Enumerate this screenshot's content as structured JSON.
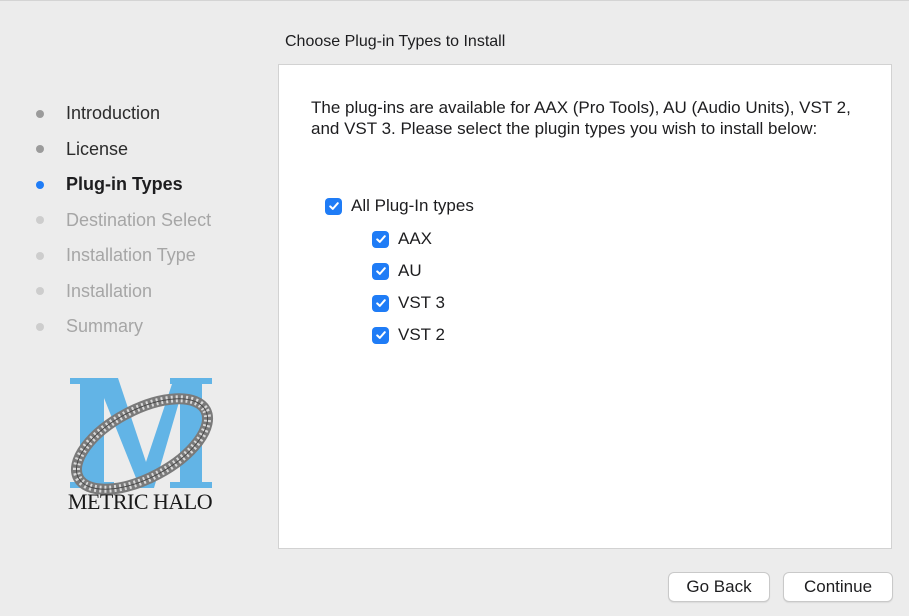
{
  "header": {
    "title": "Choose Plug-in Types to Install"
  },
  "sidebar": {
    "steps": [
      {
        "label": "Introduction",
        "state": "done"
      },
      {
        "label": "License",
        "state": "done"
      },
      {
        "label": "Plug-in Types",
        "state": "current"
      },
      {
        "label": "Destination Select",
        "state": "pending"
      },
      {
        "label": "Installation Type",
        "state": "pending"
      },
      {
        "label": "Installation",
        "state": "pending"
      },
      {
        "label": "Summary",
        "state": "pending"
      }
    ]
  },
  "logo": {
    "text": "METRIC HALO",
    "icon": "metric-halo-logo"
  },
  "main": {
    "description": "The plug-ins are available for AAX (Pro Tools), AU (Audio Units), VST 2, and VST 3. Please select the plugin types you wish to install below:",
    "all_option": {
      "label": "All Plug-In types",
      "checked": true
    },
    "options": [
      {
        "label": "AAX",
        "checked": true
      },
      {
        "label": "AU",
        "checked": true
      },
      {
        "label": "VST 3",
        "checked": true
      },
      {
        "label": "VST 2",
        "checked": true
      }
    ]
  },
  "footer": {
    "back_label": "Go Back",
    "continue_label": "Continue"
  },
  "colors": {
    "accent": "#1f7cf6",
    "logo_blue": "#62b4e6"
  }
}
